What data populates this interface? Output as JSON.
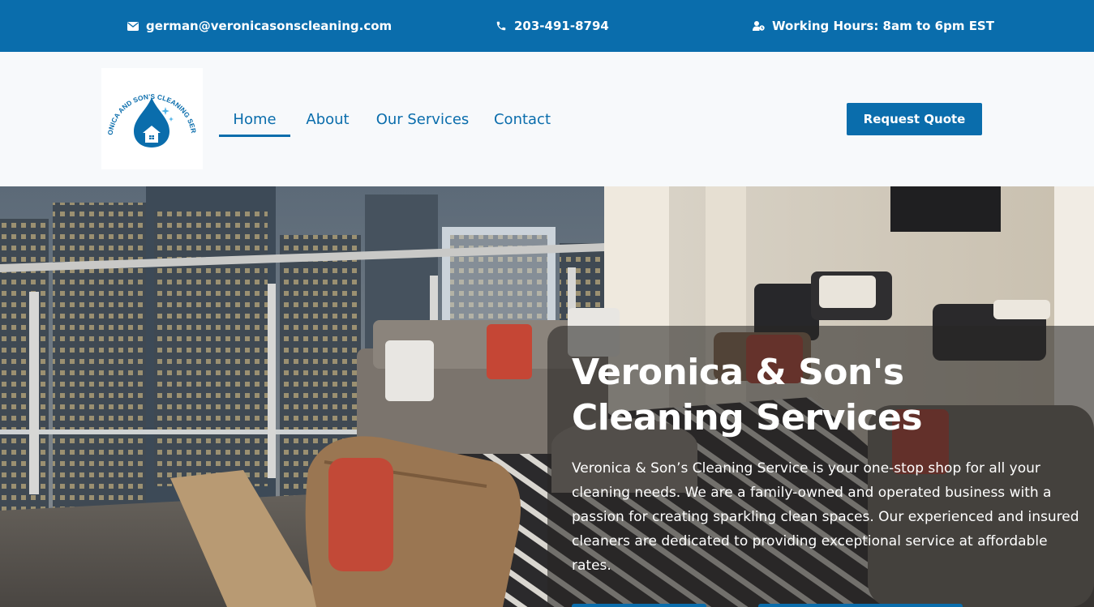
{
  "topbar": {
    "email": "german@veronicasonscleaning.com",
    "phone": "203-491-8794",
    "hours": "Working Hours: 8am to 6pm EST",
    "icons": [
      "envelope-icon",
      "phone-icon",
      "user-clock-icon"
    ]
  },
  "logo": {
    "text": "VERONICA AND SON'S CLEANING SERVICE"
  },
  "nav": {
    "items": [
      {
        "label": "Home",
        "active": true
      },
      {
        "label": "About",
        "active": false
      },
      {
        "label": "Our Services",
        "active": false
      },
      {
        "label": "Contact",
        "active": false
      }
    ]
  },
  "header": {
    "cta_label": "Request Quote"
  },
  "hero": {
    "title": "Veronica & Son's Cleaning Services",
    "description": "Veronica & Son’s Cleaning Service is your one-stop shop for all your cleaning needs. We are a family-owned and operated business with a passion for creating sparkling clean spaces. Our experienced and insured cleaners are dedicated to providing exceptional service at affordable rates."
  },
  "colors": {
    "brand_blue": "#0a6dac",
    "header_bg": "#f7f9fb",
    "text_on_dark": "#ffffff"
  }
}
